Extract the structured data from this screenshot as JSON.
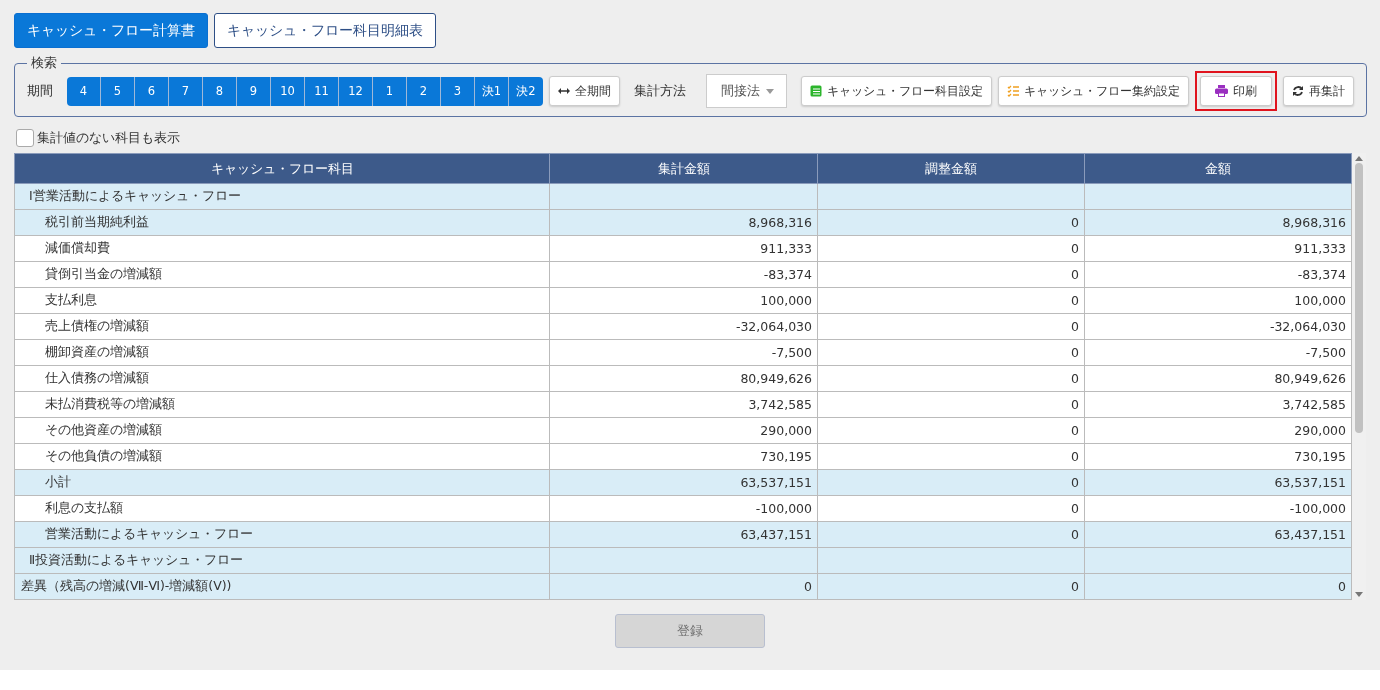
{
  "report_tabs": [
    {
      "label": "キャッシュ・フロー計算書",
      "selected": true
    },
    {
      "label": "キャッシュ・フロー科目明細表",
      "selected": false
    }
  ],
  "search": {
    "legend": "検索",
    "period_label": "期間",
    "periods": [
      {
        "label": "4",
        "selected": true
      },
      {
        "label": "5",
        "selected": true
      },
      {
        "label": "6",
        "selected": true
      },
      {
        "label": "7",
        "selected": true
      },
      {
        "label": "8",
        "selected": true
      },
      {
        "label": "9",
        "selected": true
      },
      {
        "label": "10",
        "selected": true
      },
      {
        "label": "11",
        "selected": true
      },
      {
        "label": "12",
        "selected": true
      },
      {
        "label": "1",
        "selected": true
      },
      {
        "label": "2",
        "selected": true
      },
      {
        "label": "3",
        "selected": true
      },
      {
        "label": "決1",
        "selected": true
      },
      {
        "label": "決2",
        "selected": true
      }
    ],
    "all_period_button": "全期間",
    "method_label": "集計方法",
    "method_value": "間接法",
    "actions": [
      {
        "kind": "table",
        "label": "キャッシュ・フロー科目設定",
        "highlighted": false
      },
      {
        "kind": "list",
        "label": "キャッシュ・フロー集約設定",
        "highlighted": false
      },
      {
        "kind": "print",
        "label": "印刷",
        "highlighted": true
      },
      {
        "kind": "refresh",
        "label": "再集計",
        "highlighted": false
      }
    ]
  },
  "show_empty": {
    "label": "集計値のない科目も表示",
    "checked": false
  },
  "table": {
    "columns": [
      "キャッシュ・フロー科目",
      "集計金額",
      "調整金額",
      "金額"
    ],
    "rows": [
      {
        "kind": "heading",
        "shaded": true,
        "cells": [
          "Ⅰ営業活動によるキャッシュ・フロー",
          "",
          "",
          ""
        ]
      },
      {
        "kind": "item",
        "shaded": true,
        "cells": [
          "税引前当期純利益",
          "8,968,316",
          "0",
          "8,968,316"
        ]
      },
      {
        "kind": "item",
        "shaded": false,
        "cells": [
          "減価償却費",
          "911,333",
          "0",
          "911,333"
        ]
      },
      {
        "kind": "item",
        "shaded": false,
        "cells": [
          "貸倒引当金の増減額",
          "-83,374",
          "0",
          "-83,374"
        ]
      },
      {
        "kind": "item",
        "shaded": false,
        "cells": [
          "支払利息",
          "100,000",
          "0",
          "100,000"
        ]
      },
      {
        "kind": "item",
        "shaded": false,
        "cells": [
          "売上債権の増減額",
          "-32,064,030",
          "0",
          "-32,064,030"
        ]
      },
      {
        "kind": "item",
        "shaded": false,
        "cells": [
          "棚卸資産の増減額",
          "-7,500",
          "0",
          "-7,500"
        ]
      },
      {
        "kind": "item",
        "shaded": false,
        "cells": [
          "仕入債務の増減額",
          "80,949,626",
          "0",
          "80,949,626"
        ]
      },
      {
        "kind": "item",
        "shaded": false,
        "cells": [
          "未払消費税等の増減額",
          "3,742,585",
          "0",
          "3,742,585"
        ]
      },
      {
        "kind": "item",
        "shaded": false,
        "cells": [
          "その他資産の増減額",
          "290,000",
          "0",
          "290,000"
        ]
      },
      {
        "kind": "item",
        "shaded": false,
        "cells": [
          "その他負債の増減額",
          "730,195",
          "0",
          "730,195"
        ]
      },
      {
        "kind": "item",
        "shaded": true,
        "cells": [
          "小計",
          "63,537,151",
          "0",
          "63,537,151"
        ]
      },
      {
        "kind": "item",
        "shaded": false,
        "cells": [
          "利息の支払額",
          "-100,000",
          "0",
          "-100,000"
        ]
      },
      {
        "kind": "item",
        "shaded": true,
        "cells": [
          "営業活動によるキャッシュ・フロー",
          "63,437,151",
          "0",
          "63,437,151"
        ]
      },
      {
        "kind": "heading",
        "shaded": true,
        "cells": [
          "Ⅱ投資活動によるキャッシュ・フロー",
          "",
          "",
          ""
        ]
      },
      {
        "kind": "plain",
        "shaded": true,
        "cells": [
          "差異（残高の増減(Ⅶ-Ⅵ)-増減額(Ⅴ))",
          "0",
          "0",
          "0"
        ]
      }
    ]
  },
  "register_button": {
    "label": "登録",
    "disabled": true
  }
}
